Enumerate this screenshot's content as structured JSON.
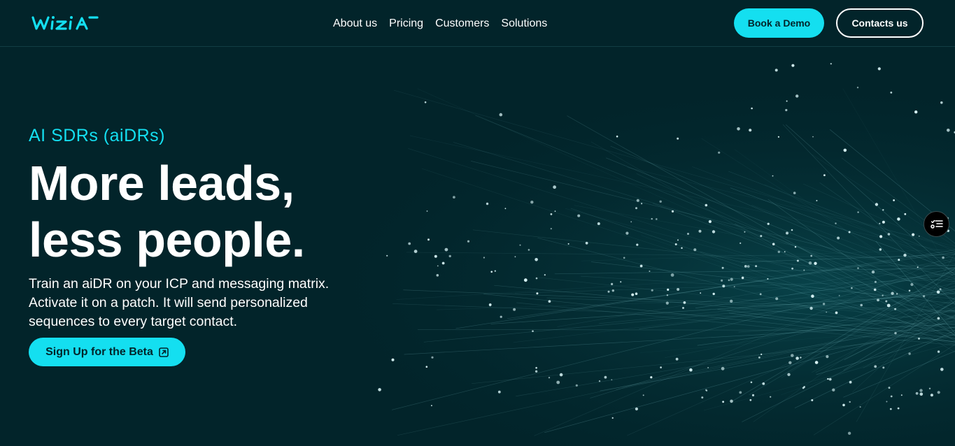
{
  "brand": {
    "logo_text": "wizia",
    "accent_color": "#14dff0",
    "background_color": "#02242a"
  },
  "nav": {
    "items": [
      {
        "label": "About us"
      },
      {
        "label": "Pricing"
      },
      {
        "label": "Customers"
      },
      {
        "label": "Solutions"
      }
    ]
  },
  "header_actions": {
    "book_demo_label": "Book a Demo",
    "contacts_label": "Contacts us"
  },
  "hero": {
    "eyebrow": "AI SDRs (aiDRs)",
    "headline_lines": [
      "More leads,",
      "less people."
    ],
    "subtext_lines": [
      "Train an aiDR on your ICP and messaging matrix.",
      "Activate it on a patch. It will send personalized",
      "sequences to every target contact."
    ],
    "cta_label": "Sign Up for the Beta",
    "cta_icon": "external-link-icon"
  },
  "widget": {
    "icon": "checklist-icon"
  }
}
